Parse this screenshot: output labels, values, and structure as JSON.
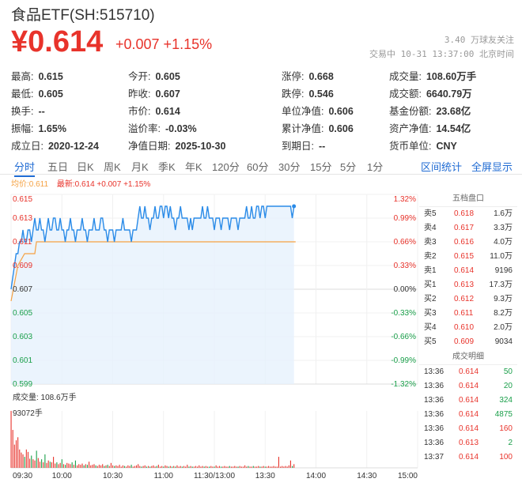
{
  "header": {
    "title": "食品ETF(SH:515710)",
    "price": "¥0.614",
    "change": "+0.007 +1.15%",
    "follow": "3.40 万球友关注",
    "status": "交易中 10-31 13:37:00 北京时间"
  },
  "stats": [
    [
      {
        "label": "最高:",
        "value": "0.615",
        "color": "red"
      },
      {
        "label": "今开:",
        "value": "0.605",
        "color": "green"
      },
      {
        "label": "涨停:",
        "value": "0.668",
        "color": "red"
      },
      {
        "label": "成交量:",
        "value": "108.60万手",
        "color": ""
      }
    ],
    [
      {
        "label": "最低:",
        "value": "0.605",
        "color": "green"
      },
      {
        "label": "昨收:",
        "value": "0.607",
        "color": ""
      },
      {
        "label": "跌停:",
        "value": "0.546",
        "color": "green"
      },
      {
        "label": "成交额:",
        "value": "6640.79万",
        "color": ""
      }
    ],
    [
      {
        "label": "换手:",
        "value": "--",
        "color": ""
      },
      {
        "label": "市价:",
        "value": "0.614",
        "color": ""
      },
      {
        "label": "单位净值:",
        "value": "0.606",
        "color": ""
      },
      {
        "label": "基金份额:",
        "value": "23.68亿",
        "color": ""
      }
    ],
    [
      {
        "label": "振幅:",
        "value": "1.65%",
        "color": ""
      },
      {
        "label": "溢价率:",
        "value": "-0.03%",
        "color": ""
      },
      {
        "label": "累计净值:",
        "value": "0.606",
        "color": ""
      },
      {
        "label": "资产净值:",
        "value": "14.54亿",
        "color": ""
      }
    ],
    [
      {
        "label": "成立日:",
        "value": "2020-12-24",
        "color": ""
      },
      {
        "label": "净值日期:",
        "value": "2025-10-30",
        "color": ""
      },
      {
        "label": "到期日:",
        "value": "--",
        "color": ""
      },
      {
        "label": "货币单位:",
        "value": "CNY",
        "color": ""
      }
    ]
  ],
  "tabs": [
    "分时",
    "五日",
    "日K",
    "周K",
    "月K",
    "季K",
    "年K",
    "120分",
    "60分",
    "30分",
    "15分",
    "5分",
    "1分"
  ],
  "tabs_right": [
    "区间统计",
    "全屏显示"
  ],
  "legend": {
    "avg": "均价:0.611",
    "latest": "最新:0.614 +0.007 +1.15%"
  },
  "volume": {
    "label": "成交量: 108.6万手",
    "max": "93072手"
  },
  "colors": {
    "up": "#e8332b",
    "down": "#1a9f4a",
    "price_line": "#2a8be8",
    "avg_line": "#f5a142",
    "accent": "#1f6bd3"
  },
  "orderbook": {
    "title": "五档盘口",
    "asks": [
      {
        "label": "卖5",
        "price": "0.618",
        "vol": "1.6万"
      },
      {
        "label": "卖4",
        "price": "0.617",
        "vol": "3.3万"
      },
      {
        "label": "卖3",
        "price": "0.616",
        "vol": "4.0万"
      },
      {
        "label": "卖2",
        "price": "0.615",
        "vol": "11.0万"
      },
      {
        "label": "卖1",
        "price": "0.614",
        "vol": "9196"
      }
    ],
    "bids": [
      {
        "label": "买1",
        "price": "0.613",
        "vol": "17.3万"
      },
      {
        "label": "买2",
        "price": "0.612",
        "vol": "9.3万"
      },
      {
        "label": "买3",
        "price": "0.611",
        "vol": "8.2万"
      },
      {
        "label": "买4",
        "price": "0.610",
        "vol": "2.0万"
      },
      {
        "label": "买5",
        "price": "0.609",
        "vol": "9034"
      }
    ]
  },
  "trades": {
    "title": "成交明细",
    "rows": [
      {
        "time": "13:36",
        "price": "0.614",
        "vol": "50",
        "side": "down"
      },
      {
        "time": "13:36",
        "price": "0.614",
        "vol": "20",
        "side": "down"
      },
      {
        "time": "13:36",
        "price": "0.614",
        "vol": "324",
        "side": "down"
      },
      {
        "time": "13:36",
        "price": "0.614",
        "vol": "4875",
        "side": "down"
      },
      {
        "time": "13:36",
        "price": "0.614",
        "vol": "160",
        "side": "up"
      },
      {
        "time": "13:36",
        "price": "0.613",
        "vol": "2",
        "side": "down"
      },
      {
        "time": "13:37",
        "price": "0.614",
        "vol": "100",
        "side": "up"
      }
    ]
  },
  "chart_data": {
    "type": "line",
    "ylim": [
      0.599,
      0.615
    ],
    "y_ticks_left": [
      "0.615",
      "0.613",
      "0.611",
      "0.609",
      "0.607",
      "0.605",
      "0.603",
      "0.601",
      "0.599"
    ],
    "y_ticks_right": [
      "1.32%",
      "0.99%",
      "0.66%",
      "0.33%",
      "0.00%",
      "-0.33%",
      "-0.66%",
      "-0.99%",
      "-1.32%"
    ],
    "x_ticks": [
      "09:30",
      "10:00",
      "10:30",
      "11:00",
      "11:30/13:00",
      "13:30",
      "14:00",
      "14:30",
      "15:00"
    ],
    "prev_close": 0.607,
    "total_minutes": 240,
    "price_series": [
      0.607,
      0.608,
      0.609,
      0.61,
      0.61,
      0.611,
      0.611,
      0.612,
      0.611,
      0.611,
      0.612,
      0.612,
      0.611,
      0.612,
      0.613,
      0.612,
      0.612,
      0.613,
      0.612,
      0.612,
      0.611,
      0.612,
      0.613,
      0.612,
      0.612,
      0.613,
      0.613,
      0.612,
      0.612,
      0.613,
      0.612,
      0.612,
      0.611,
      0.612,
      0.612,
      0.613,
      0.612,
      0.612,
      0.611,
      0.612,
      0.612,
      0.612,
      0.613,
      0.612,
      0.612,
      0.611,
      0.612,
      0.612,
      0.612,
      0.613,
      0.612,
      0.612,
      0.612,
      0.613,
      0.613,
      0.612,
      0.612,
      0.611,
      0.612,
      0.612,
      0.612,
      0.611,
      0.612,
      0.612,
      0.612,
      0.612,
      0.613,
      0.612,
      0.612,
      0.612,
      0.612,
      0.611,
      0.612,
      0.612,
      0.612,
      0.613,
      0.614,
      0.613,
      0.613,
      0.614,
      0.613,
      0.613,
      0.612,
      0.613,
      0.613,
      0.614,
      0.613,
      0.613,
      0.614,
      0.614,
      0.613,
      0.614,
      0.614,
      0.613,
      0.614,
      0.613,
      0.613,
      0.612,
      0.613,
      0.613,
      0.614,
      0.613,
      0.613,
      0.613,
      0.613,
      0.612,
      0.613,
      0.612,
      0.613,
      0.613,
      0.613,
      0.613,
      0.613,
      0.614,
      0.613,
      0.613,
      0.614,
      0.613,
      0.613,
      0.613,
      0.612,
      0.613,
      0.613,
      0.613,
      0.612,
      0.613,
      0.613,
      0.613,
      0.613,
      0.612,
      0.613,
      0.613,
      0.613,
      0.613,
      0.612,
      0.613,
      0.613,
      0.613,
      0.613,
      0.614,
      0.613,
      0.613,
      0.614,
      0.613,
      0.613,
      0.614,
      0.614,
      0.613,
      0.614,
      0.614,
      0.613,
      0.614,
      0.614,
      0.614,
      0.614,
      0.614,
      0.614,
      0.614,
      0.614,
      0.614,
      0.614,
      0.614,
      0.614,
      0.614,
      0.614,
      0.614,
      0.613,
      0.614
    ],
    "avg_series_points": [
      [
        0,
        0.606
      ],
      [
        4,
        0.609
      ],
      [
        8,
        0.61
      ],
      [
        14,
        0.61
      ],
      [
        15,
        0.611
      ],
      [
        168,
        0.611
      ]
    ],
    "volume_series": [
      93072,
      62000,
      38000,
      45000,
      50000,
      30000,
      25000,
      22000,
      18000,
      30000,
      26000,
      15000,
      20000,
      14000,
      12000,
      28000,
      16000,
      10000,
      14000,
      9000,
      22000,
      8000,
      12000,
      10000,
      9000,
      18000,
      7000,
      9000,
      6000,
      8000,
      14000,
      6000,
      5000,
      8000,
      7000,
      6000,
      9000,
      5000,
      12000,
      4000,
      6000,
      5000,
      7000,
      4000,
      6000,
      5000,
      10000,
      4000,
      5000,
      6000,
      4000,
      3000,
      5000,
      4000,
      6000,
      3000,
      4000,
      5000,
      3000,
      8000,
      4000,
      3000,
      4000,
      3000,
      5000,
      2000,
      4000,
      3000,
      2000,
      4000,
      3000,
      5000,
      2000,
      3000,
      4000,
      6000,
      3000,
      2000,
      3000,
      4000,
      2000,
      3000,
      2000,
      3000,
      4000,
      2000,
      3000,
      5000,
      2000,
      3000,
      2000,
      4000,
      3000,
      2000,
      3000,
      2000,
      3000,
      2000,
      4000,
      2000,
      3000,
      2000,
      3000,
      2000,
      5000,
      2000,
      3000,
      2000,
      2000,
      3000,
      2000,
      4000,
      2000,
      3000,
      2000,
      3000,
      2000,
      2000,
      3000,
      2000,
      2000,
      4000,
      2000,
      3000,
      2000,
      2000,
      3000,
      2000,
      2000,
      3000,
      2000,
      2000,
      3000,
      2000,
      2000,
      3000,
      2000,
      2000,
      4000,
      2000,
      3000,
      2000,
      2000,
      3000,
      2000,
      2000,
      3000,
      2000,
      2000,
      3000,
      2000,
      2000,
      3000,
      2000,
      2000,
      3000,
      2000,
      2000,
      18000,
      2000,
      3000,
      2000,
      3000,
      2000,
      4000,
      12000,
      3000,
      6000
    ]
  }
}
